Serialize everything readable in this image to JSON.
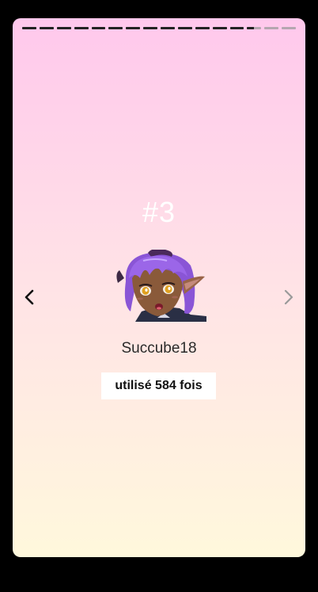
{
  "story": {
    "segments_total": 16,
    "segments_viewed": 13,
    "current_segment_progress": 0.5
  },
  "rank": {
    "label": "#3"
  },
  "user": {
    "name": "Succube18",
    "avatar": "purple-haired-elf-girl-avatar"
  },
  "usage": {
    "label": "utilisé 584 fois"
  },
  "nav": {
    "prev_icon": "chevron-left-icon",
    "next_icon": "chevron-right-icon"
  },
  "colors": {
    "gradient_top": "#ffc8ec",
    "gradient_bottom": "#fff8dc",
    "progress_done": "#222222",
    "progress_todo": "#b5a6b0"
  }
}
